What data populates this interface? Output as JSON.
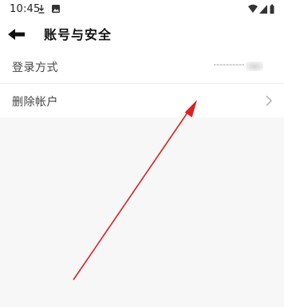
{
  "status_bar": {
    "time": "10:45",
    "left_icons": [
      "download-icon",
      "image-icon"
    ],
    "right_icons": [
      "wifi-icon",
      "signal-icon",
      "battery-icon"
    ]
  },
  "header": {
    "back_icon": "back-arrow-icon",
    "title": "账号与安全"
  },
  "settings": [
    {
      "label": "登录方式",
      "value_obscured": true
    },
    {
      "label": "删除帐户",
      "chevron_icon": "chevron-right-icon"
    }
  ],
  "annotation": {
    "arrow_color": "#e02020"
  },
  "colors": {
    "background": "#f7f7f7",
    "surface": "#ffffff",
    "text_primary": "#111111",
    "text_secondary": "#444444",
    "divider": "#ececec"
  }
}
